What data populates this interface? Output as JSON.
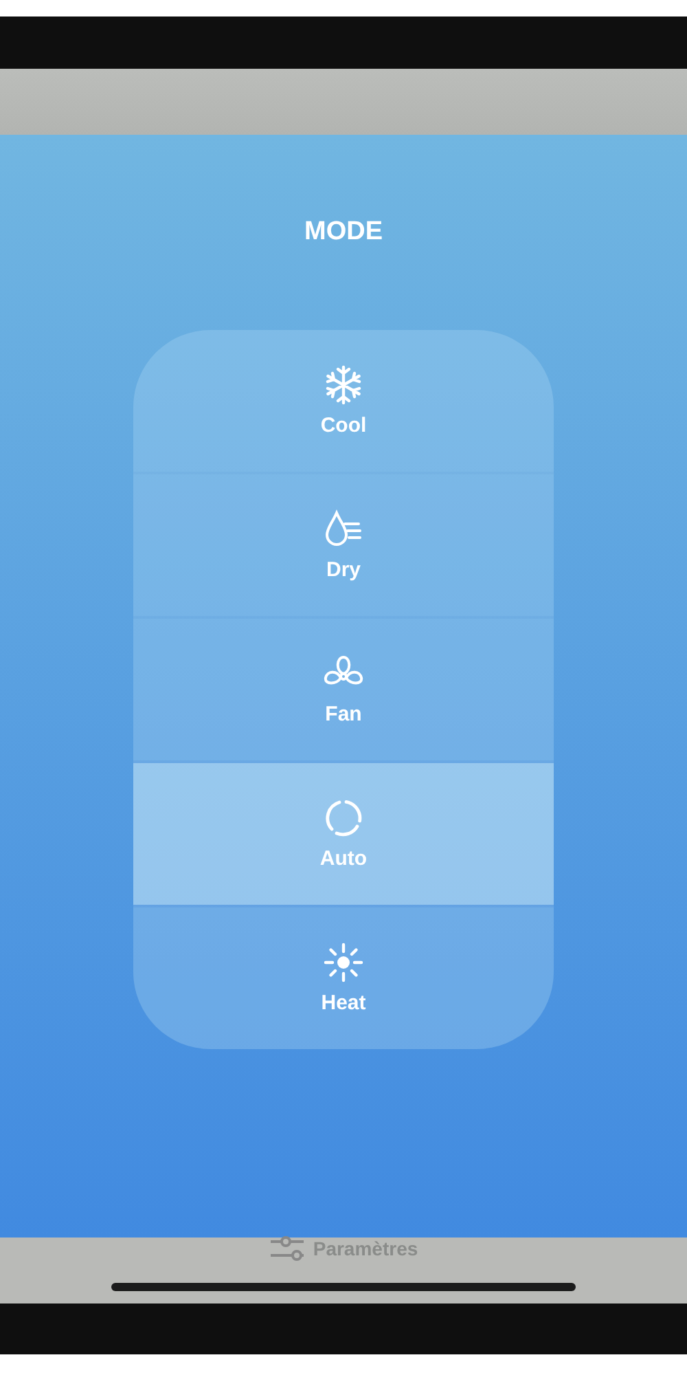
{
  "title": "MODE",
  "modes": [
    {
      "label": "Cool",
      "kind": "cool",
      "selected": false
    },
    {
      "label": "Dry",
      "kind": "dry",
      "selected": false
    },
    {
      "label": "Fan",
      "kind": "fan",
      "selected": false
    },
    {
      "label": "Auto",
      "kind": "auto",
      "selected": true
    },
    {
      "label": "Heat",
      "kind": "heat",
      "selected": false
    }
  ],
  "bottom_bar": {
    "label": "Paramètres"
  }
}
